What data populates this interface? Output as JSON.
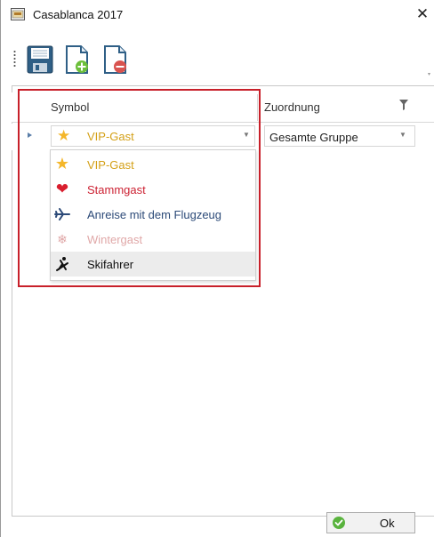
{
  "window": {
    "title": "Casablanca 2017",
    "close_glyph": "✕"
  },
  "toolbar": {
    "buttons": [
      {
        "icon": "save-icon"
      },
      {
        "icon": "add-document-icon"
      },
      {
        "icon": "delete-document-icon"
      }
    ]
  },
  "grid": {
    "columns": [
      {
        "label": "Symbol"
      },
      {
        "label": "Zuordnung"
      }
    ],
    "current_row": {
      "symbol": {
        "label": "VIP-Gast",
        "icon": "star-icon"
      },
      "zuordnung": "Gesamte Gruppe"
    }
  },
  "dropdown": {
    "options": [
      {
        "label": "VIP-Gast",
        "icon": "star-icon",
        "color": "#d4a017"
      },
      {
        "label": "Stammgast",
        "icon": "heart-icon",
        "color": "#cc2233"
      },
      {
        "label": "Anreise mit dem Flugzeug",
        "icon": "airplane-icon",
        "color": "#2c4a78"
      },
      {
        "label": "Wintergast",
        "icon": "snowflake-icon",
        "color": "#e0a8a8"
      },
      {
        "label": "Skifahrer",
        "icon": "skier-icon",
        "color": "#111111"
      }
    ],
    "hovered": "Skifahrer"
  },
  "footer": {
    "ok_label": "Ok"
  },
  "colors": {
    "highlight": "#c8202a",
    "accent": "#5a7ea8"
  }
}
